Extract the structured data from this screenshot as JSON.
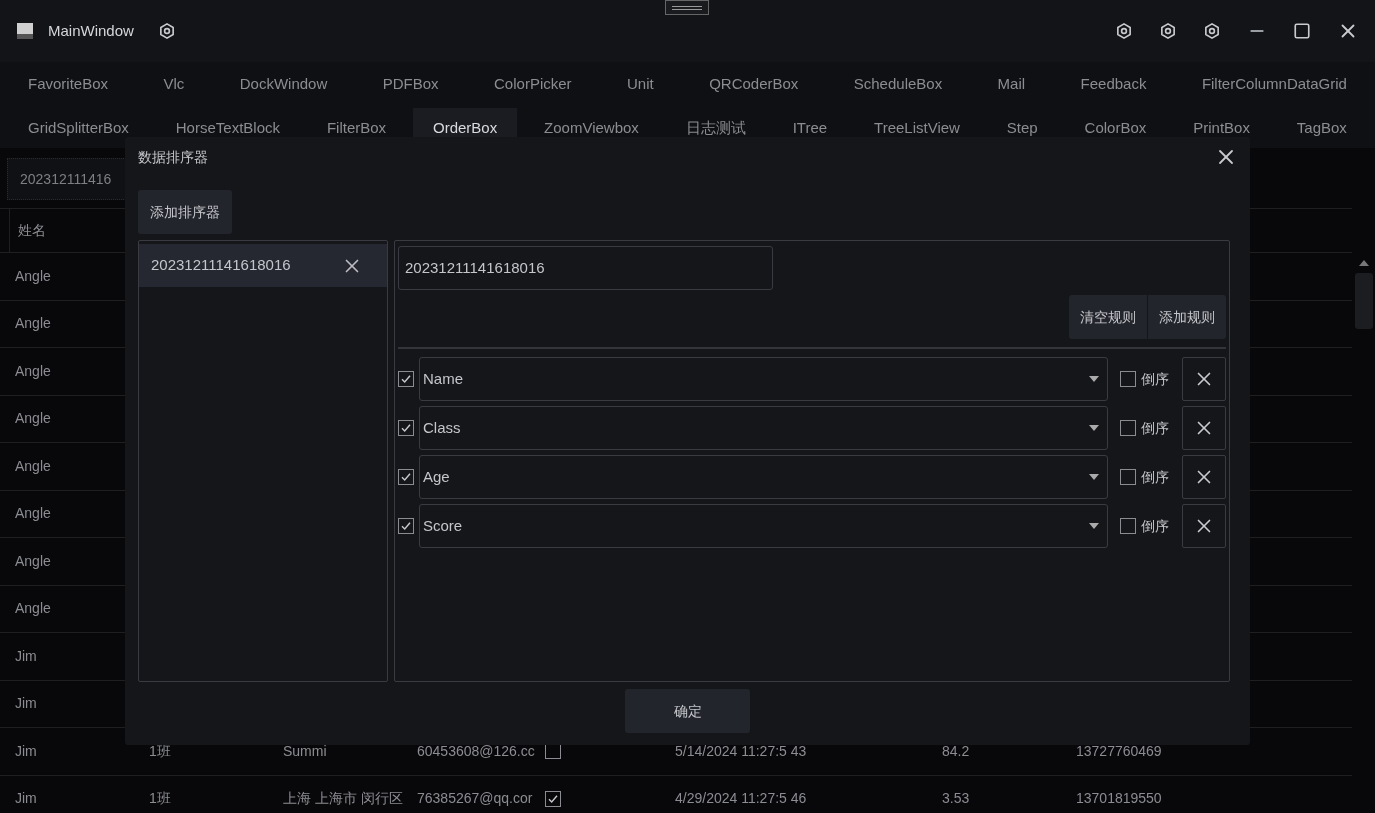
{
  "window": {
    "title": "MainWindow"
  },
  "tab_rows": [
    {
      "tabs": [
        {
          "label": "FavoriteBox",
          "selected": false
        },
        {
          "label": "Vlc",
          "selected": false
        },
        {
          "label": "DockWindow",
          "selected": false
        },
        {
          "label": "PDFBox",
          "selected": false
        },
        {
          "label": "ColorPicker",
          "selected": false
        },
        {
          "label": "Unit",
          "selected": false
        },
        {
          "label": "QRCoderBox",
          "selected": false
        },
        {
          "label": "ScheduleBox",
          "selected": false
        },
        {
          "label": "Mail",
          "selected": false
        },
        {
          "label": "Feedback",
          "selected": false
        },
        {
          "label": "FilterColumnDataGrid",
          "selected": false
        }
      ]
    },
    {
      "tabs": [
        {
          "label": "GridSplitterBox",
          "selected": false
        },
        {
          "label": "HorseTextBlock",
          "selected": false
        },
        {
          "label": "FilterBox",
          "selected": false
        },
        {
          "label": "OrderBox",
          "selected": true
        },
        {
          "label": "ZoomViewbox",
          "selected": false
        },
        {
          "label": "日志测试",
          "selected": false
        },
        {
          "label": "ITree",
          "selected": false
        },
        {
          "label": "TreeListView",
          "selected": false
        },
        {
          "label": "Step",
          "selected": false
        },
        {
          "label": "ColorBox",
          "selected": false
        },
        {
          "label": "PrintBox",
          "selected": false
        },
        {
          "label": "TagBox",
          "selected": false
        }
      ]
    }
  ],
  "order_field": {
    "value": "202312111416"
  },
  "grid": {
    "columns": [
      "姓名"
    ],
    "rows": [
      {
        "cells": [
          "Angle"
        ]
      },
      {
        "cells": [
          "Angle"
        ]
      },
      {
        "cells": [
          "Angle"
        ]
      },
      {
        "cells": [
          "Angle"
        ]
      },
      {
        "cells": [
          "Angle"
        ]
      },
      {
        "cells": [
          "Angle"
        ]
      },
      {
        "cells": [
          "Angle"
        ]
      },
      {
        "cells": [
          "Angle"
        ]
      },
      {
        "cells": [
          "Jim"
        ]
      },
      {
        "cells": [
          "Jim"
        ]
      },
      {
        "cells": [
          "Jim",
          "1班",
          "Summi",
          "60453608@126.cc"
        ],
        "checked": false,
        "more": [
          "5/14/2024 11:27:5 43",
          "84.2",
          "13727760469"
        ]
      },
      {
        "cells": [
          "Jim",
          "1班",
          "上海 上海市 闵行区",
          "76385267@qq.cor"
        ],
        "checked": true,
        "more": [
          "4/29/2024 11:27:5 46",
          "3.53",
          "13701819550"
        ]
      }
    ]
  },
  "dialog": {
    "title": "数据排序器",
    "add_sorter": "添加排序器",
    "sorters": [
      {
        "label": "20231211141618016",
        "selected": true
      }
    ],
    "name_field": {
      "value": "20231211141618016"
    },
    "clear_rules": "清空规则",
    "add_rule": "添加规则",
    "rules": [
      {
        "enabled": true,
        "field": "Name",
        "descending": false,
        "descending_label": "倒序"
      },
      {
        "enabled": true,
        "field": "Class",
        "descending": false,
        "descending_label": "倒序"
      },
      {
        "enabled": true,
        "field": "Age",
        "descending": false,
        "descending_label": "倒序"
      },
      {
        "enabled": true,
        "field": "Score",
        "descending": false,
        "descending_label": "倒序"
      }
    ],
    "confirm": "确定"
  }
}
